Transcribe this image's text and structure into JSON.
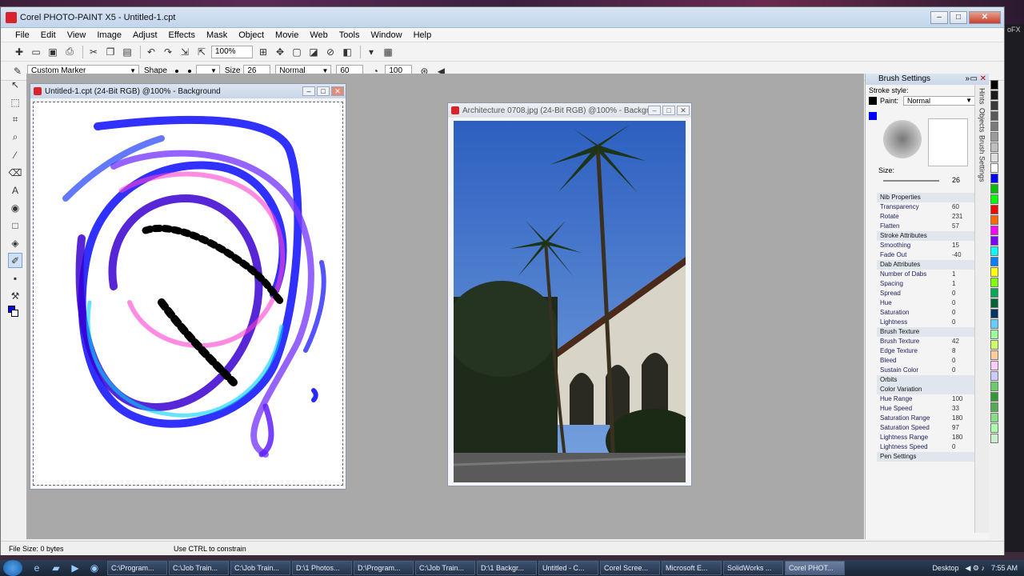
{
  "app": {
    "title": "Corel PHOTO-PAINT X5 - Untitled-1.cpt"
  },
  "desktop": {
    "corner_text": "oFX"
  },
  "menu": [
    "File",
    "Edit",
    "View",
    "Image",
    "Adjust",
    "Effects",
    "Mask",
    "Object",
    "Movie",
    "Web",
    "Tools",
    "Window",
    "Help"
  ],
  "toolbar": {
    "zoom": "100%"
  },
  "propbar": {
    "brush_preset": "Custom Marker",
    "shape_label": "Shape",
    "size_label": "Size",
    "size_value": "26",
    "merge_mode": "Normal",
    "transparency": "60",
    "extra": "100"
  },
  "docs": [
    {
      "title": "Untitled-1.cpt (24-Bit RGB) @100% - Background"
    },
    {
      "title": "Architecture 0708.jpg (24-Bit RGB) @100% - Backgr..."
    }
  ],
  "docker": {
    "title": "Brush Settings",
    "stroke_style_label": "Stroke style:",
    "paint_label": "Paint:",
    "paint_value": "Normal",
    "size_label": "Size:",
    "size_value": "26",
    "tabs": [
      "Hints",
      "Objects",
      "Brush Settings"
    ],
    "properties": [
      {
        "k": "Nib Properties",
        "v": "",
        "sec": true
      },
      {
        "k": "Transparency",
        "v": "60"
      },
      {
        "k": "Rotate",
        "v": "231"
      },
      {
        "k": "Flatten",
        "v": "57"
      },
      {
        "k": "Stroke Attributes",
        "v": "",
        "sec": true
      },
      {
        "k": "Smoothing",
        "v": "15"
      },
      {
        "k": "Fade Out",
        "v": "-40"
      },
      {
        "k": "Dab Attributes",
        "v": "",
        "sec": true
      },
      {
        "k": "Number of Dabs",
        "v": "1"
      },
      {
        "k": "Spacing",
        "v": "1"
      },
      {
        "k": "Spread",
        "v": "0"
      },
      {
        "k": "Hue",
        "v": "0"
      },
      {
        "k": "Saturation",
        "v": "0"
      },
      {
        "k": "Lightness",
        "v": "0"
      },
      {
        "k": "Brush Texture",
        "v": "",
        "sec": true
      },
      {
        "k": "Brush Texture",
        "v": "42"
      },
      {
        "k": "Edge Texture",
        "v": "8"
      },
      {
        "k": "Bleed",
        "v": "0"
      },
      {
        "k": "Sustain Color",
        "v": "0"
      },
      {
        "k": "Orbits",
        "v": "",
        "sec": true
      },
      {
        "k": "Color Variation",
        "v": "",
        "sec": true
      },
      {
        "k": "Hue Range",
        "v": "100"
      },
      {
        "k": "Hue Speed",
        "v": "33"
      },
      {
        "k": "Saturation Range",
        "v": "180"
      },
      {
        "k": "Saturation Speed",
        "v": "97"
      },
      {
        "k": "Lightness Range",
        "v": "180"
      },
      {
        "k": "Lightness Speed",
        "v": "0"
      },
      {
        "k": "Pen Settings",
        "v": "",
        "sec": true
      }
    ]
  },
  "palette": [
    "#000000",
    "#1b1b1b",
    "#3a3a3a",
    "#5a5a5a",
    "#7a7a7a",
    "#9a9a9a",
    "#bdbdbd",
    "#dedede",
    "#ffffff",
    "#0000ff",
    "#00c000",
    "#00ff00",
    "#ff0000",
    "#ff6600",
    "#ff00ff",
    "#8000ff",
    "#00ffff",
    "#0080ff",
    "#ffff00",
    "#80ff00",
    "#00aa55",
    "#006633",
    "#003366",
    "#66ccff",
    "#99ff99",
    "#ccff66",
    "#ffcc99",
    "#ffccff",
    "#ccccff",
    "#66cc66",
    "#339933",
    "#55aa55",
    "#88dd88",
    "#aaffaa",
    "#cceecc"
  ],
  "status": {
    "file_size": "File Size: 0 bytes",
    "hint": "Use CTRL to constrain"
  },
  "taskbar": {
    "tasks": [
      "C:\\Program...",
      "C:\\Job Train...",
      "C:\\Job Train...",
      "D:\\1 Photos...",
      "D:\\Program...",
      "C:\\Job Train...",
      "D:\\1 Backgr...",
      "Untitled - C...",
      "Corel Scree...",
      "Microsoft E...",
      "SolidWorks ...",
      "Corel PHOT..."
    ],
    "desktop_label": "Desktop",
    "time": "7:55 AM"
  }
}
